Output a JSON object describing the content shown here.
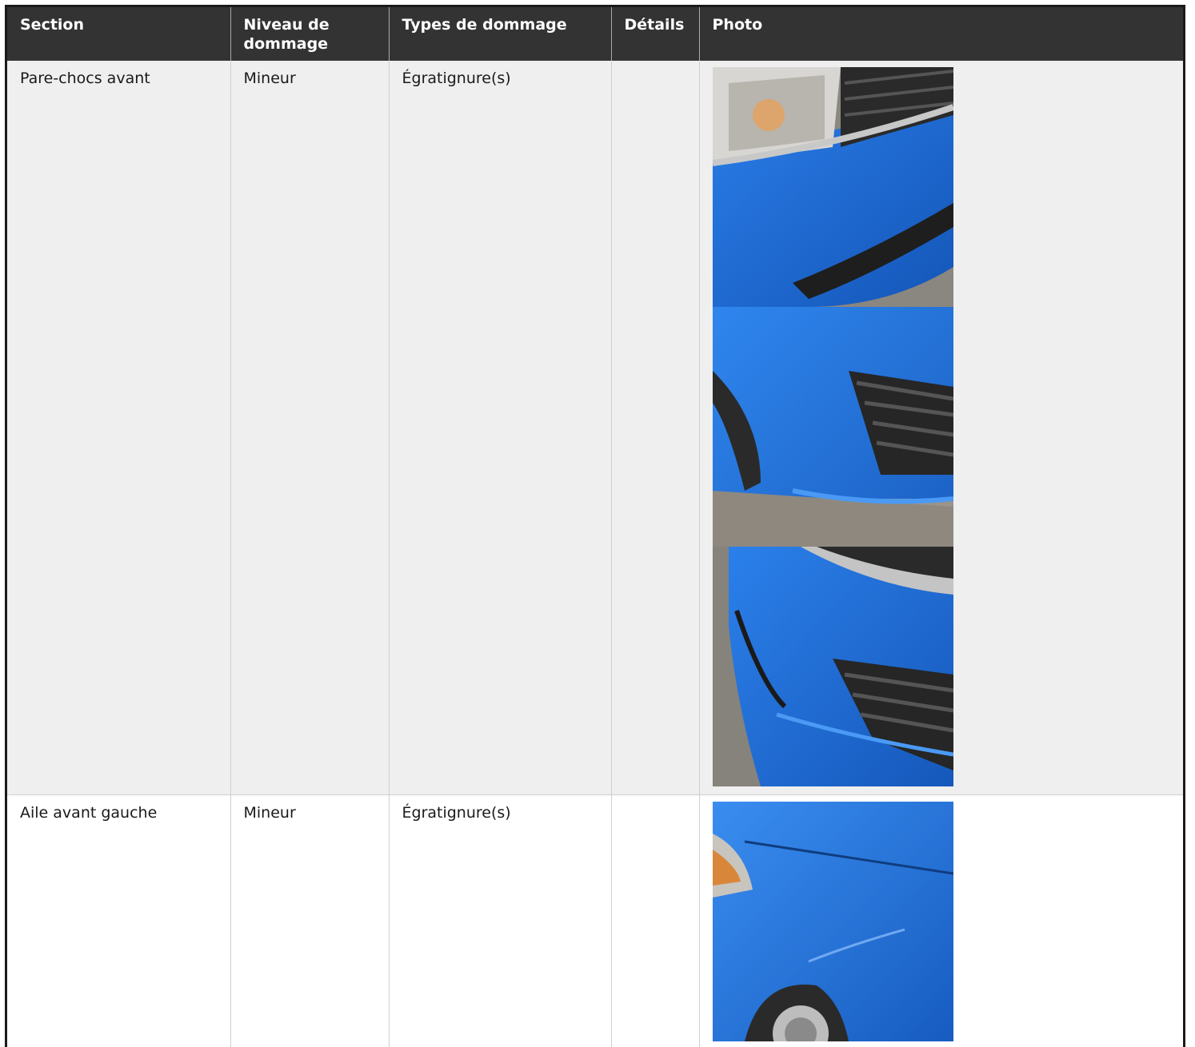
{
  "headers": {
    "section": "Section",
    "niveau": "Niveau de dommage",
    "types": "Types de dommage",
    "details": "Détails",
    "photo": "Photo"
  },
  "rows": [
    {
      "section": "Pare-chocs avant",
      "niveau": "Mineur",
      "types": "Égratignure(s)",
      "details": "",
      "photos": [
        "front-bumper-headlight-photo",
        "front-bumper-fog-grille-photo",
        "front-bumper-corner-photo"
      ]
    },
    {
      "section": "Aile avant gauche",
      "niveau": "Mineur",
      "types": "Égratignure(s)",
      "details": "",
      "photos": [
        "left-front-fender-photo"
      ]
    }
  ],
  "colors": {
    "header_bg": "#333333",
    "row_alt_bg": "#efefef",
    "car_blue": "#1f6fd6"
  }
}
